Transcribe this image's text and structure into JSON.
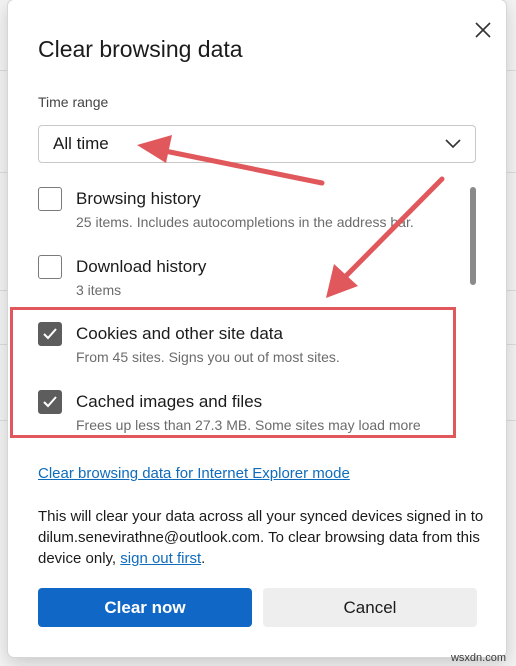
{
  "dialog": {
    "title": "Clear browsing data",
    "close_icon": "close-icon"
  },
  "time_range": {
    "label": "Time range",
    "value": "All time",
    "icon": "chevron-down-icon"
  },
  "items": [
    {
      "title": "Browsing history",
      "desc": "25 items. Includes autocompletions in the address bar.",
      "checked": false
    },
    {
      "title": "Download history",
      "desc": "3 items",
      "checked": false
    },
    {
      "title": "Cookies and other site data",
      "desc": "From 45 sites. Signs you out of most sites.",
      "checked": true
    },
    {
      "title": "Cached images and files",
      "desc": "Frees up less than 27.3 MB. Some sites may load more",
      "checked": true
    }
  ],
  "ie_link": "Clear browsing data for Internet Explorer mode",
  "sync": {
    "text": "This will clear your data across all your synced devices signed in to dilum.senevirathne@outlook.com. To clear browsing data from this device only, ",
    "link": "sign out first",
    "end": "."
  },
  "buttons": {
    "primary": "Clear now",
    "secondary": "Cancel"
  },
  "annotation_color": "#e0585b",
  "watermark": "wsxdn.com"
}
